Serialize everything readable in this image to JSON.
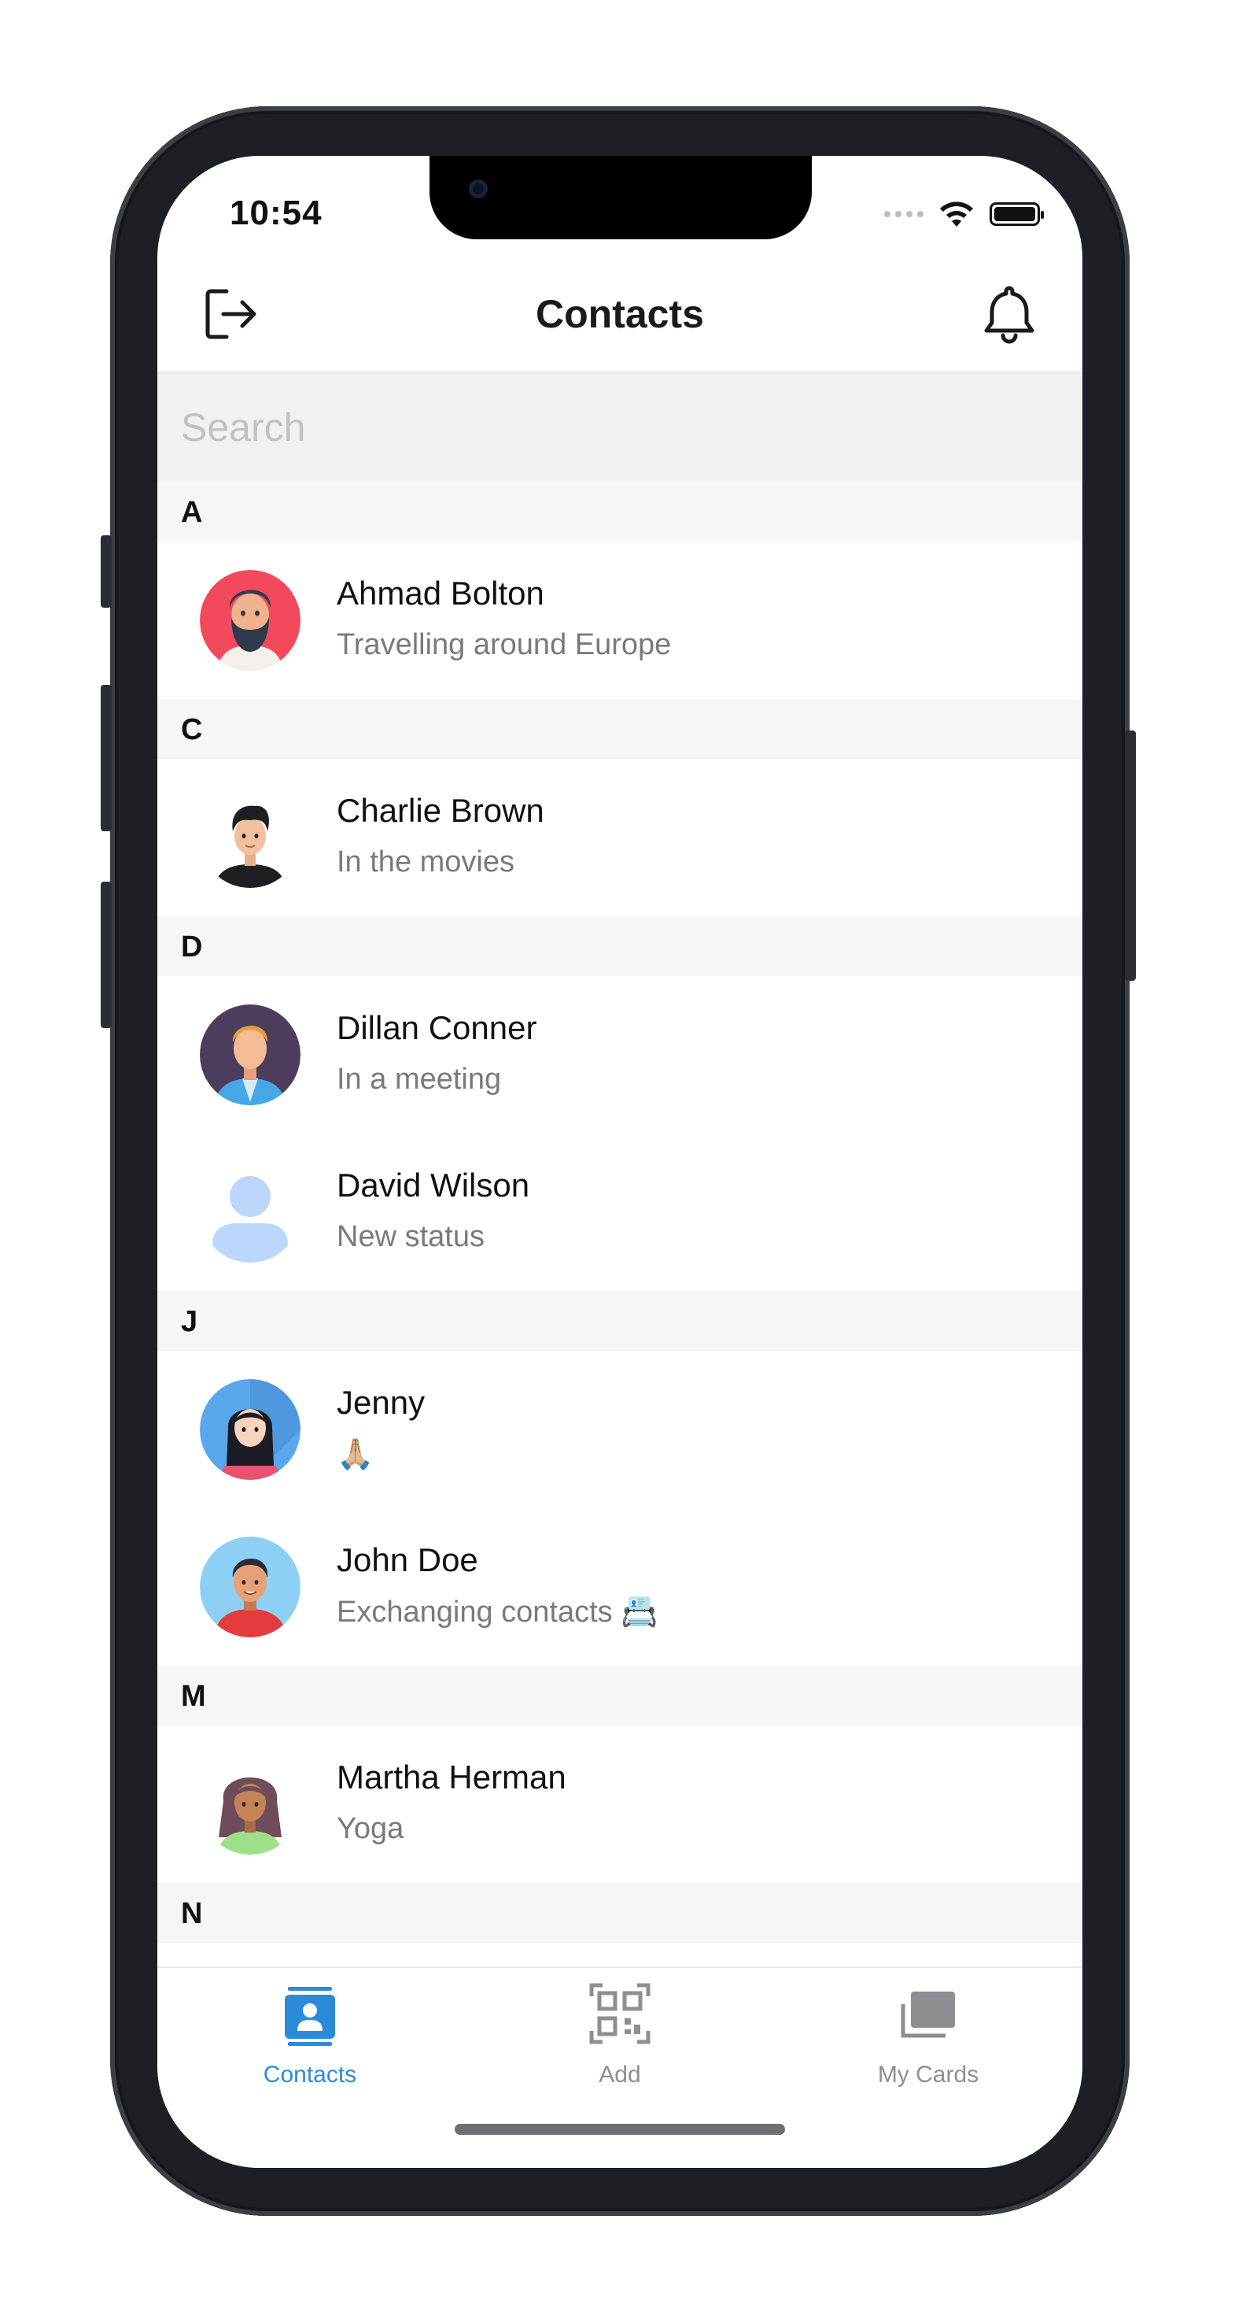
{
  "status_bar": {
    "time": "10:54"
  },
  "header": {
    "title": "Contacts",
    "left_icon": "logout-icon",
    "right_icon": "bell-icon"
  },
  "search": {
    "placeholder": "Search",
    "value": ""
  },
  "sections": [
    {
      "letter": "A",
      "contacts": [
        {
          "name": "Ahmad Bolton",
          "status": "Travelling around Europe",
          "avatar": "bearded-man-red-bg"
        }
      ]
    },
    {
      "letter": "C",
      "contacts": [
        {
          "name": "Charlie Brown",
          "status": "In the movies",
          "avatar": "young-man-black-shirt"
        }
      ]
    },
    {
      "letter": "D",
      "contacts": [
        {
          "name": "Dillan Conner",
          "status": "In a meeting",
          "avatar": "blonde-man-suit"
        },
        {
          "name": "David Wilson",
          "status": "New status",
          "avatar": "placeholder-person"
        }
      ]
    },
    {
      "letter": "J",
      "contacts": [
        {
          "name": "Jenny",
          "status": "🙏🏼",
          "avatar": "woman-dark-hair-blue-bg"
        },
        {
          "name": "John Doe",
          "status": "Exchanging contacts 📇",
          "avatar": "man-red-hoodie"
        }
      ]
    },
    {
      "letter": "M",
      "contacts": [
        {
          "name": "Martha Herman",
          "status": "Yoga",
          "avatar": "woman-curly-hair"
        }
      ]
    },
    {
      "letter": "N",
      "contacts": []
    }
  ],
  "tabbar": {
    "tabs": [
      {
        "label": "Contacts",
        "icon": "contacts-icon",
        "active": true
      },
      {
        "label": "Add",
        "icon": "qr-code-icon",
        "active": false
      },
      {
        "label": "My Cards",
        "icon": "cards-icon",
        "active": false
      }
    ],
    "active_color": "#2b8bd9",
    "inactive_color": "#8e8e93"
  }
}
